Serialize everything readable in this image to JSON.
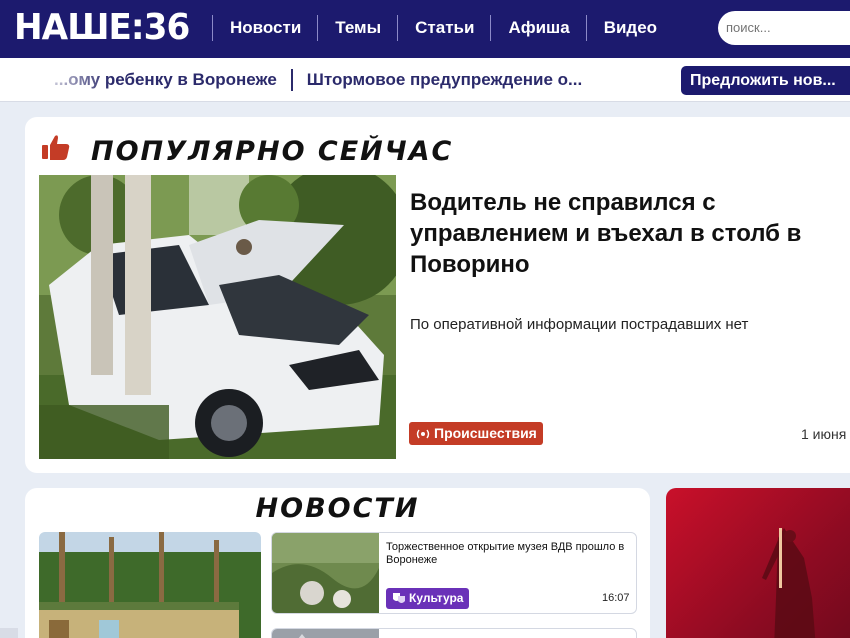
{
  "header": {
    "logo": "НАШЕ:36",
    "nav": [
      "Новости",
      "Темы",
      "Статьи",
      "Афиша",
      "Видео"
    ],
    "search_placeholder": "поиск..."
  },
  "ticker": {
    "items": [
      "...ому ребенку в Воронеже",
      "Штормовое предупреждение о..."
    ],
    "suggest_button": "Предложить нов..."
  },
  "popular": {
    "title": "ПОПУЛЯРНО СЕЙЧАС",
    "headline": "Водитель не справился с управлением и въехал в столб в Поворино",
    "lead": "По оперативной информации пострадавших нет",
    "tag": "Происшествия",
    "date": "1 июня"
  },
  "news": {
    "title": "НОВОСТИ",
    "items": [
      {
        "text": "Торжественное открытие музея ВДВ прошло в Воронеже",
        "tag": "Культура",
        "time": "16:07"
      }
    ]
  },
  "colors": {
    "header_bg": "#1c1a6e",
    "tag_incidents": "#c43c26",
    "tag_culture": "#6a31b8",
    "promo_red": "#c9102a"
  }
}
